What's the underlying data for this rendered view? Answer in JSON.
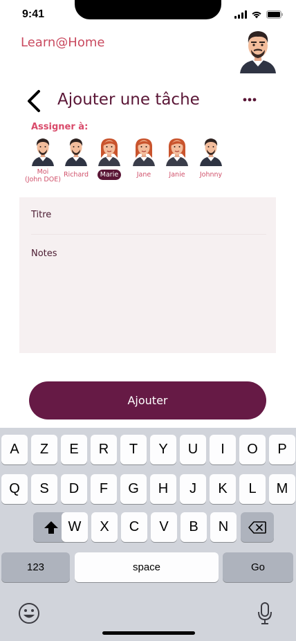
{
  "status": {
    "time": "9:41"
  },
  "header": {
    "brand": "Learn@Home",
    "title": "Ajouter une tâche",
    "assign_label": "Assigner à:"
  },
  "assignees": [
    {
      "name": "Moi\n(John DOE)",
      "gender": "male",
      "selected": false
    },
    {
      "name": "Richard",
      "gender": "male",
      "selected": false
    },
    {
      "name": "Marie",
      "gender": "female",
      "selected": true
    },
    {
      "name": "Jane",
      "gender": "female",
      "selected": false
    },
    {
      "name": "Janie",
      "gender": "female",
      "selected": false
    },
    {
      "name": "Johnny",
      "gender": "male",
      "selected": false
    }
  ],
  "form": {
    "title_placeholder": "Titre",
    "notes_placeholder": "Notes"
  },
  "submit_label": "Ajouter",
  "keyboard": {
    "row1": [
      "A",
      "Z",
      "E",
      "R",
      "T",
      "Y",
      "U",
      "I",
      "O",
      "P"
    ],
    "row2": [
      "Q",
      "S",
      "D",
      "F",
      "G",
      "H",
      "J",
      "K",
      "L",
      "M"
    ],
    "row3": [
      "W",
      "X",
      "C",
      "V",
      "B",
      "N"
    ],
    "numbers_label": "123",
    "space_label": "space",
    "go_label": "Go"
  },
  "colors": {
    "accent": "#661a45",
    "brand": "#c94a5f",
    "label": "#d94a6a",
    "keyboard_bg": "#d1d4db"
  }
}
